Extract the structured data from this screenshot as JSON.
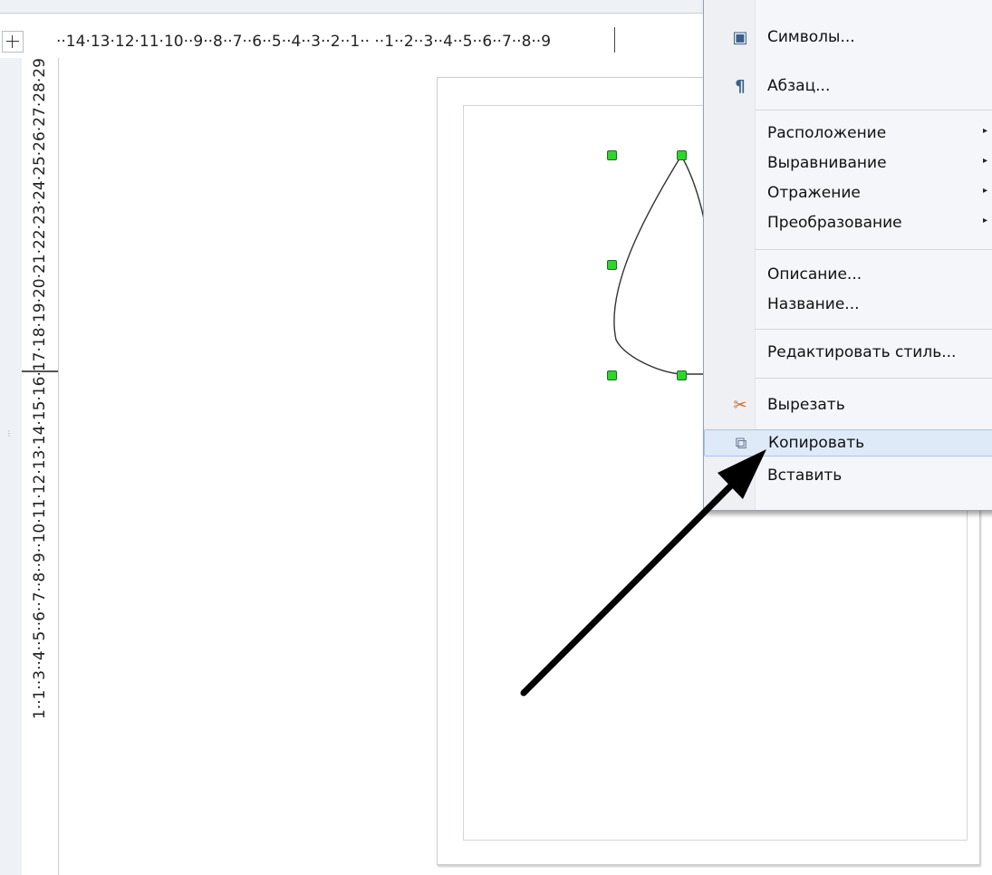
{
  "ruler": {
    "horizontal_ticks": "··14·13·12·11·10··9··8··7··6··5··4··3··2··1··  ··1··2··3··4··5··6··7··8··9",
    "vertical_ticks": "1··1··3··4··5··6··7··8··9··10·11·12·13·14·15·16·17·18·19·20·21·22·23·24·25·26·27·28·29"
  },
  "context_menu": {
    "items": [
      {
        "label": "Символы...",
        "icon": "characters-icon"
      },
      {
        "label": "Абзац...",
        "icon": "paragraph-icon"
      },
      {
        "label": "Расположение",
        "submenu": true
      },
      {
        "label": "Выравнивание",
        "submenu": true
      },
      {
        "label": "Отражение",
        "submenu": true
      },
      {
        "label": "Преобразование",
        "submenu": true
      },
      {
        "label": "Описание..."
      },
      {
        "label": "Название..."
      },
      {
        "label": "Редактировать стиль..."
      },
      {
        "label": "Вырезать",
        "icon": "scissors-icon"
      },
      {
        "label": "Копировать",
        "icon": "copy-icon",
        "highlighted": true
      },
      {
        "label": "Вставить",
        "icon": "paste-icon"
      }
    ],
    "submenu_arrow": "▸"
  },
  "colors": {
    "handle_fill": "#2dd62d",
    "menu_highlight": "#dfeaf8",
    "arrow": "#000000"
  }
}
